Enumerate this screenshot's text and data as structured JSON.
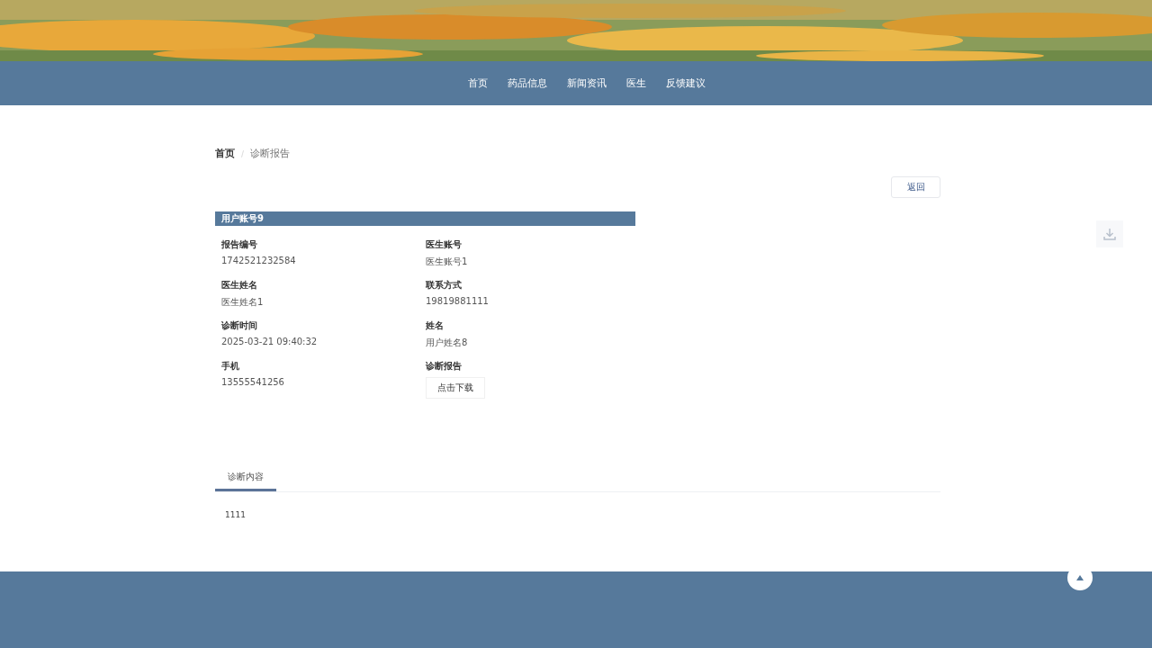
{
  "nav": [
    {
      "label": "首页"
    },
    {
      "label": "药品信息"
    },
    {
      "label": "新闻资讯"
    },
    {
      "label": "医生"
    },
    {
      "label": "反馈建议"
    }
  ],
  "breadcrumb": [
    {
      "label": "首页"
    },
    {
      "label": "诊断报告"
    }
  ],
  "back_button": "返回",
  "card": {
    "title": "用户账号9",
    "fields": [
      {
        "label": "报告编号",
        "value": "1742521232584",
        "kind": "text"
      },
      {
        "label": "医生账号",
        "value": "医生账号1",
        "kind": "text"
      },
      {
        "label": "医生姓名",
        "value": "医生姓名1",
        "kind": "text"
      },
      {
        "label": "联系方式",
        "value": "19819881111",
        "kind": "text"
      },
      {
        "label": "诊断时间",
        "value": "2025-03-21 09:40:32",
        "kind": "text"
      },
      {
        "label": "姓名",
        "value": "用户姓名8",
        "kind": "text"
      },
      {
        "label": "手机",
        "value": "13555541256",
        "kind": "text"
      },
      {
        "label": "诊断报告",
        "value": "点击下载",
        "kind": "button"
      }
    ]
  },
  "tabs": [
    {
      "label": "诊断内容",
      "selected": true
    }
  ],
  "tab_content": "1111"
}
